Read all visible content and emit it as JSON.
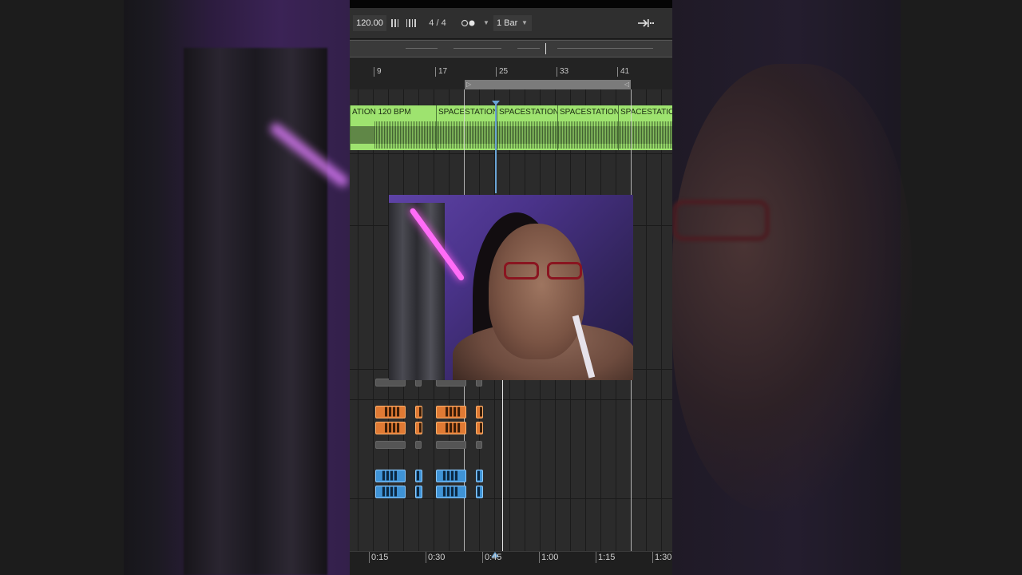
{
  "transport": {
    "tempo": "120.00",
    "tap_icon": "tap-tempo-icon",
    "metronome_icon": "metronome-icon",
    "time_signature": "4 / 4",
    "record_mode_icon": "record-mode-icon",
    "quantization": "1 Bar",
    "follow_icon": "follow-icon"
  },
  "ruler": {
    "bars": [
      "9",
      "17",
      "25",
      "33",
      "41"
    ]
  },
  "clip": {
    "name_partial": "ATION 120 BPM",
    "name": "SPACESTATION",
    "color": "#9ee36f"
  },
  "midi_colors": {
    "orange": "#e07a34",
    "blue": "#3f93d6"
  },
  "timeline": {
    "times": [
      "0:15",
      "0:30",
      "0:45",
      "1:00",
      "1:15",
      "1:30"
    ]
  },
  "playhead_color": "#6aa5d6"
}
